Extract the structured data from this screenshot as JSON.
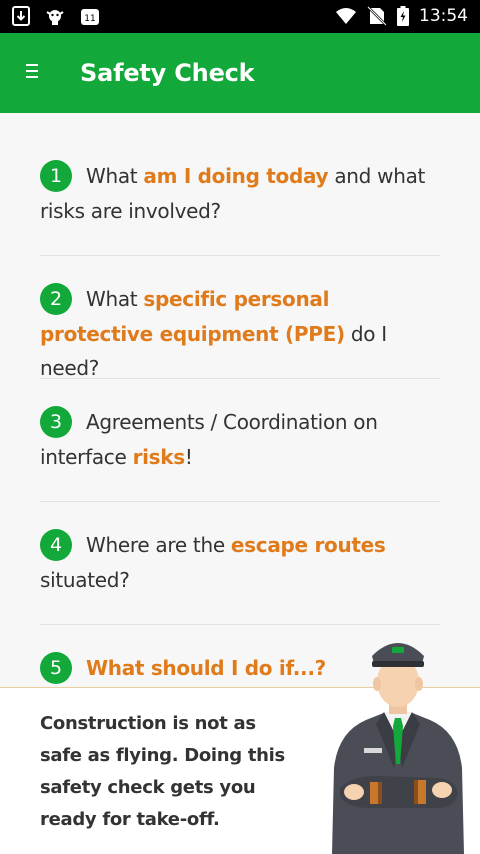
{
  "status_bar": {
    "time": "13:54",
    "left_icons": [
      "download-icon",
      "android-icon",
      "calendar-icon"
    ],
    "right_icons": [
      "wifi-icon",
      "no-sim-icon",
      "battery-charging-icon"
    ]
  },
  "app_bar": {
    "title": "Safety Check",
    "menu_icon": "menu-icon"
  },
  "checklist": [
    {
      "number": "1",
      "parts": [
        {
          "t": "What ",
          "hl": false
        },
        {
          "t": "am I doing today",
          "hl": true
        },
        {
          "t": " and what risks are involved?",
          "hl": false
        }
      ]
    },
    {
      "number": "2",
      "parts": [
        {
          "t": "What ",
          "hl": false
        },
        {
          "t": "specific personal protective equipment (PPE)",
          "hl": true
        },
        {
          "t": " do I need?",
          "hl": false
        }
      ]
    },
    {
      "number": "3",
      "parts": [
        {
          "t": "Agreements / Coordination on interface ",
          "hl": false
        },
        {
          "t": "risks",
          "hl": true
        },
        {
          "t": "!",
          "hl": false
        }
      ]
    },
    {
      "number": "4",
      "parts": [
        {
          "t": "Where are the ",
          "hl": false
        },
        {
          "t": "escape routes",
          "hl": true
        },
        {
          "t": " situated?",
          "hl": false
        }
      ]
    },
    {
      "number": "5",
      "parts": [
        {
          "t": "What should I do if...?",
          "hl": true
        }
      ]
    }
  ],
  "footer": {
    "text": "Construction is not as safe as flying. Doing this safety check gets you ready for take-off."
  },
  "colors": {
    "brand_green": "#12a83a",
    "highlight_orange": "#e07b1c",
    "text": "#333333"
  }
}
